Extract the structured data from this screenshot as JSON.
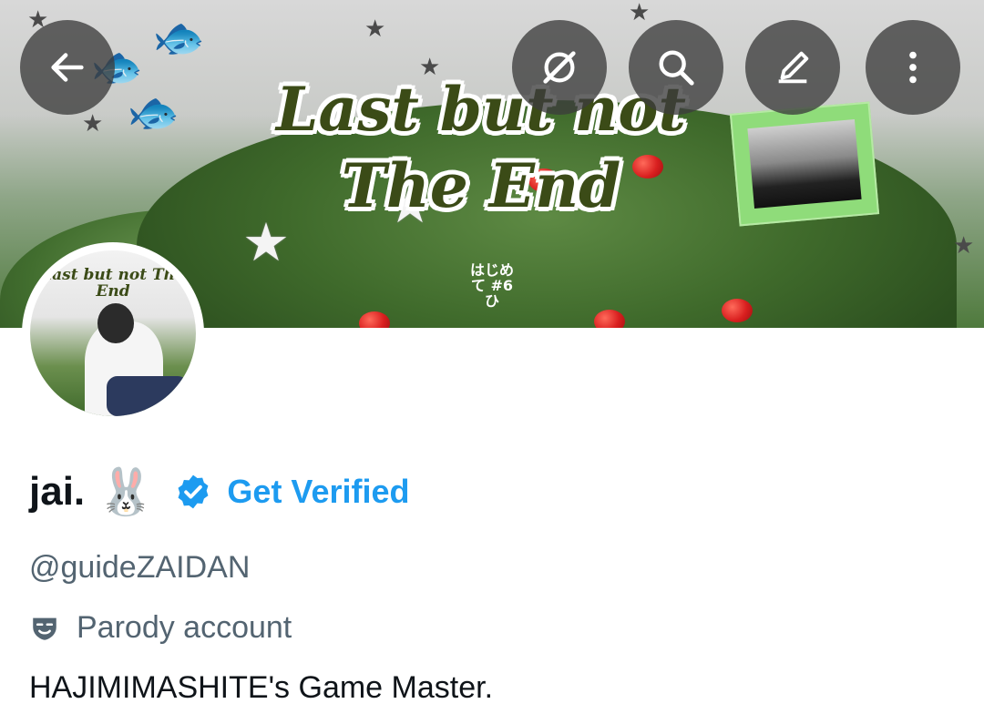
{
  "header": {
    "banner_title": "Last but not The End",
    "banner_sub": "はじめて #6ひ",
    "avatar_text": "Last but not The End"
  },
  "toolbar": {
    "back": "back-arrow-icon",
    "grok": "grok-icon",
    "search": "search-icon",
    "edit": "edit-icon",
    "more": "more-vertical-icon"
  },
  "profile": {
    "display_name": "jai.",
    "emoji": "🐰",
    "get_verified": "Get Verified",
    "handle": "@guideZAIDAN",
    "parody_label": "Parody account",
    "bio": "HAJIMIMASHITE's Game Master."
  },
  "colors": {
    "accent": "#1d9bf0",
    "secondary_text": "#536471",
    "primary_text": "#0f1419",
    "banner_title": "#3b4b17"
  }
}
